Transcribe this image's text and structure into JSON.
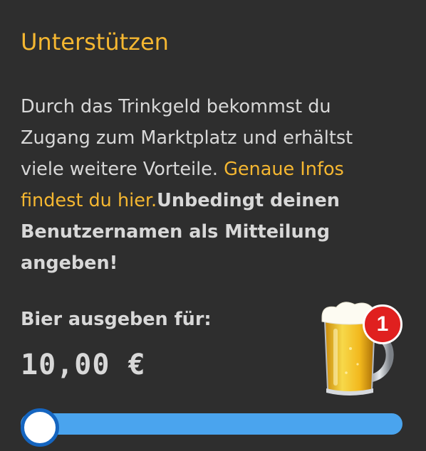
{
  "title": "Unterstützen",
  "description": {
    "text_before": "Durch das Trinkgeld bekommst du Zugang zum Marktplatz und erhältst viele weitere Vorteile. ",
    "link": "Genaue Infos findest du hier.",
    "bold_note": "Unbedingt deinen Benutzernamen als Mitteilung angeben!"
  },
  "bier_label": "Bier ausgeben für:",
  "amount_display": "10,00 €",
  "badge_count": "1",
  "slider": {
    "value_fraction": 0.0
  },
  "colors": {
    "accent": "#f5b731",
    "background": "#2e2e2e",
    "slider_track": "#4aa4ee",
    "slider_thumb_border": "#1565c0",
    "badge": "#e0201f"
  },
  "icons": {
    "beer": "beer-mug-icon"
  }
}
